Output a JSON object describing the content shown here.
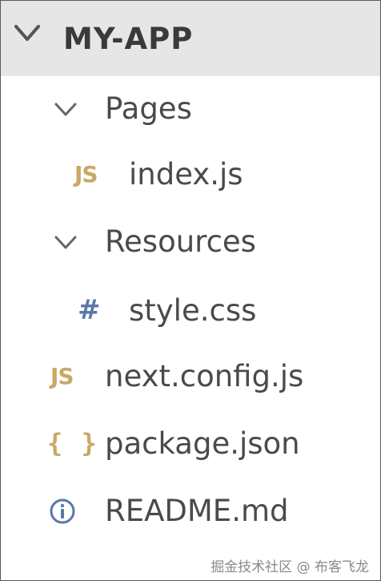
{
  "explorer": {
    "root": {
      "label": "MY-APP",
      "icon": "chevron-down-icon",
      "expanded": true
    },
    "items": [
      {
        "label": "Pages",
        "type": "folder",
        "icon": "chevron-down-icon",
        "expanded": true
      },
      {
        "label": "index.js",
        "type": "file",
        "icon": "js-file-icon",
        "icon_text": "JS"
      },
      {
        "label": "Resources",
        "type": "folder",
        "icon": "chevron-down-icon",
        "expanded": true
      },
      {
        "label": "style.css",
        "type": "file",
        "icon": "css-file-icon",
        "icon_text": "#"
      },
      {
        "label": "next.config.js",
        "type": "file",
        "icon": "js-file-icon",
        "icon_text": "JS"
      },
      {
        "label": "package.json",
        "type": "file",
        "icon": "json-file-icon",
        "icon_text": "{ }"
      },
      {
        "label": "README.md",
        "type": "file",
        "icon": "info-icon"
      }
    ]
  },
  "watermark": "掘金技术社区 @ 布客飞龙",
  "colors": {
    "header_bg": "#e6e6e6",
    "text": "#4a4a4a",
    "js_icon": "#c9a866",
    "css_icon": "#5a78a8",
    "info_icon": "#5a78a8"
  }
}
